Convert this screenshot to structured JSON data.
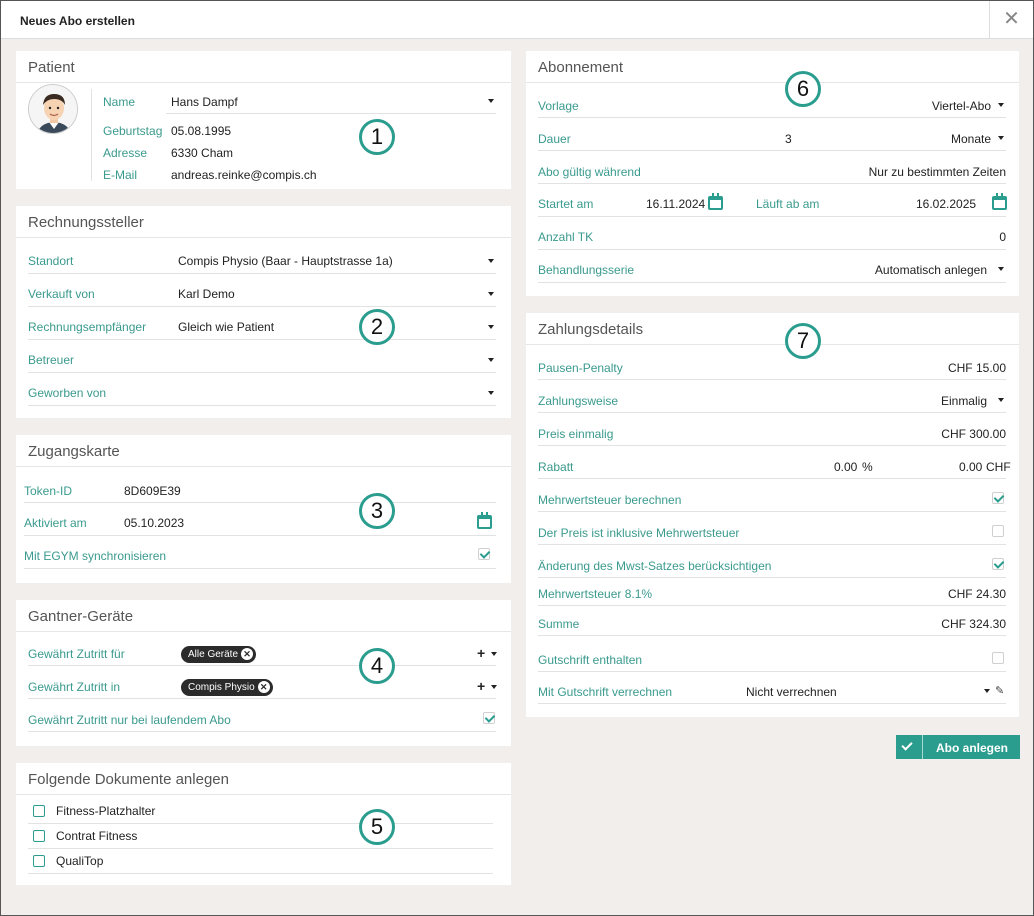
{
  "dialog": {
    "title": "Neues Abo erstellen",
    "close": "✕"
  },
  "patient": {
    "title": "Patient",
    "name_label": "Name",
    "name_value": "Hans Dampf",
    "birthday_label": "Geburtstag",
    "birthday_value": "05.08.1995",
    "address_label": "Adresse",
    "address_value": "6330 Cham",
    "email_label": "E-Mail",
    "email_value": "andreas.reinke@compis.ch"
  },
  "billing": {
    "title": "Rechnungssteller",
    "location_label": "Standort",
    "location_value": "Compis Physio (Baar - Hauptstrasse 1a)",
    "sold_by_label": "Verkauft von",
    "sold_by_value": "Karl Demo",
    "recipient_label": "Rechnungsempfänger",
    "recipient_value": "Gleich wie Patient",
    "caretaker_label": "Betreuer",
    "recruited_label": "Geworben von"
  },
  "access_card": {
    "title": "Zugangskarte",
    "token_label": "Token-ID",
    "token_value": "8D609E39",
    "activated_label": "Aktiviert am",
    "activated_value": "05.10.2023",
    "egym_label": "Mit EGYM synchronisieren"
  },
  "gantner": {
    "title": "Gantner-Geräte",
    "access_for_label": "Gewährt Zutritt für",
    "access_for_chip": "Alle Geräte",
    "access_in_label": "Gewährt Zutritt in",
    "access_in_chip": "Compis Physio",
    "running_label": "Gewährt Zutritt nur bei laufendem Abo",
    "plus": "+"
  },
  "documents": {
    "title": "Folgende Dokumente anlegen",
    "items": [
      "Fitness-Platzhalter",
      "Contrat Fitness",
      "QualiTop"
    ]
  },
  "subscription": {
    "title": "Abonnement",
    "template_label": "Vorlage",
    "template_value": "Viertel-Abo",
    "duration_label": "Dauer",
    "duration_value": "3",
    "duration_unit": "Monate",
    "valid_label": "Abo gültig während",
    "valid_value": "Nur zu bestimmten Zeiten",
    "start_label": "Startet am",
    "start_value": "16.11.2024",
    "expires_label": "Läuft ab am",
    "expires_value": "16.02.2025",
    "tk_label": "Anzahl TK",
    "tk_value": "0",
    "series_label": "Behandlungsserie",
    "series_value": "Automatisch anlegen"
  },
  "payment": {
    "title": "Zahlungsdetails",
    "penalty_label": "Pausen-Penalty",
    "penalty_value": "CHF 15.00",
    "method_label": "Zahlungsweise",
    "method_value": "Einmalig",
    "price_label": "Preis einmalig",
    "price_value": "CHF 300.00",
    "discount_label": "Rabatt",
    "discount_pct": "0.00",
    "pct_sign": "%",
    "discount_chf": "0.00",
    "chf_unit": "CHF",
    "vat_calc_label": "Mehrwertsteuer berechnen",
    "vat_incl_label": "Der Preis ist inklusive Mehrwertsteuer",
    "vat_change_label": "Änderung des Mwst-Satzes berücksichtigen",
    "vat_label": "Mehrwertsteuer 8.1%",
    "vat_value": "CHF 24.30",
    "sum_label": "Summe",
    "sum_value": "CHF 324.30",
    "credit_label": "Gutschrift enthalten",
    "offset_label": "Mit Gutschrift verrechnen",
    "offset_value": "Nicht verrechnen"
  },
  "actions": {
    "create_label": "Abo anlegen"
  },
  "markers": [
    "1",
    "2",
    "3",
    "4",
    "5",
    "6",
    "7"
  ],
  "colors": {
    "accent": "#2a9d8f",
    "label": "#3a9a8e",
    "background": "#f1eeeb"
  }
}
